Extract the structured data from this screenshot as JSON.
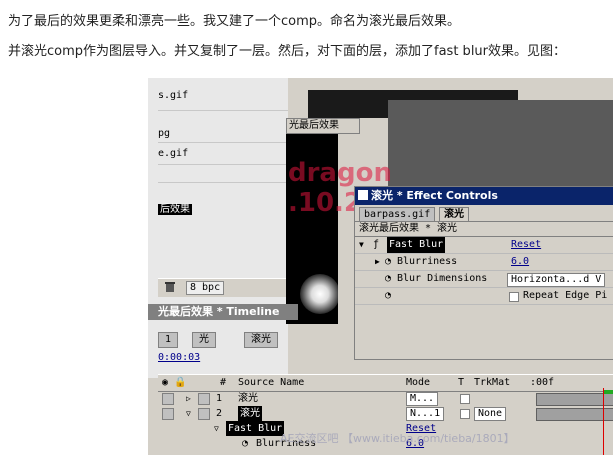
{
  "article": {
    "line1": "为了最后的效果更柔和漂亮一些。我又建了一个comp。命名为滚光最后效果。",
    "line2": "并滚光comp作为图层导入。并又复制了一层。然后，对下面的层，添加了fast blur效果。见图："
  },
  "project_panel": {
    "items": [
      "s.gif",
      "pg",
      "e.gif",
      "后效果"
    ],
    "selected_index": 3,
    "bpc_label": "8 bpc"
  },
  "comp_viewer": {
    "tab_label": "光最后效果",
    "watermark_text": "dragon",
    "watermark_text2": ".10.2"
  },
  "effect_controls": {
    "title": "滚光 * Effect Controls",
    "tabs": [
      "barpass.gif",
      "滚光"
    ],
    "active_tab_index": 1,
    "subtitle": "滚光最后效果 * 滚光",
    "effect_name": "Fast Blur",
    "reset_label": "Reset",
    "params": {
      "blurriness_label": "Blurriness",
      "blurriness_value": "6.0",
      "dimensions_label": "Blur Dimensions",
      "dimensions_value": "Horizonta...d V",
      "repeat_edge_label": "Repeat Edge Pi"
    }
  },
  "timeline": {
    "title": "光最后效果 * Timeline",
    "tabs": [
      "1",
      "光",
      "滚光"
    ],
    "time": "0:00:03",
    "headers": {
      "num": "#",
      "source": "Source Name",
      "mode": "Mode",
      "t": "T",
      "trkmat": "TrkMat",
      "time_marker": ":00f"
    },
    "layers": [
      {
        "num": "1",
        "name": "滚光",
        "mode": "M...",
        "trkmat": ""
      },
      {
        "num": "2",
        "name": "滚光",
        "mode": "N...1",
        "trkmat": "None"
      }
    ],
    "effect_row": {
      "name": "Fast Blur",
      "reset": "Reset"
    },
    "blurriness_row": {
      "name": "Blurriness",
      "value": "6.0"
    }
  },
  "watermark": "AE交流区吧 【www.itieba.com/tieba/1801】",
  "colors": {
    "title_bar": "#0a246a",
    "panel": "#d4d0c8",
    "link": "#00008b"
  }
}
